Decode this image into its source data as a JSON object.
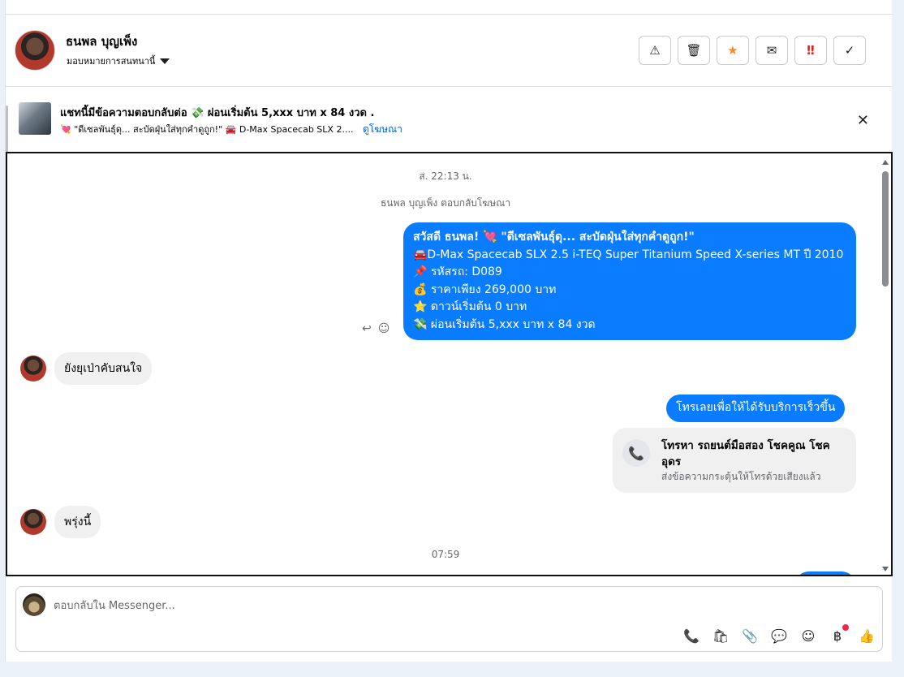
{
  "header": {
    "contact_name": "ธนพล บุญเพ็ง",
    "assign_label": "มอบหมายการสนทนานี้",
    "actions": [
      {
        "icon": "warning-icon",
        "glyph": "⚠"
      },
      {
        "icon": "trash-icon",
        "glyph": "🗑"
      },
      {
        "icon": "star-icon",
        "glyph": "★"
      },
      {
        "icon": "mark-unread-icon",
        "glyph": "✉"
      },
      {
        "icon": "important-icon",
        "glyph": "‼"
      },
      {
        "icon": "check-icon",
        "glyph": "✓"
      }
    ]
  },
  "ad": {
    "title": "แชทนี้มีข้อความตอบกลับต่อ 💸 ผ่อนเริ่มต้น 5,xxx บาท x 84 งวด .",
    "subtitle": "💘 \"ดีเซลพันธุ์ดุ... สะบัดฝุ่นใส่ทุกคำดูถูก!\" 🚘 D-Max Spacecab SLX 2....",
    "link": "ดูโฆษณา",
    "close_glyph": "✕"
  },
  "thread": {
    "timestamp1": "ส. 22:13 น.",
    "reply_note": "ธนพล บุญเพ็ง ตอบกลับโฆษณา",
    "ad_message_lines": [
      "สวัสดี ธนพล! 💘 \"ดีเซลพันธุ์ดุ... สะบัดฝุ่นใส่ทุกคำดูถูก!\"",
      "🚘D-Max Spacecab SLX 2.5 i-TEQ Super Titanium Speed X-series MT ปี 2010",
      "📌 รหัสรถ: D089",
      "💰 ราคาเพียง 269,000 บาท",
      "⭐ ดาวน์เริ่มต้น 0 บาท",
      "💸 ผ่อนเริ่มต้น 5,xxx บาท x 84 งวด"
    ],
    "reply_glyph": "↩",
    "react_glyph": "☺",
    "incoming1": "ยังยุเป่าคับสนใจ",
    "outgoing2": "โทรเลยเพื่อให้ได้รับบริการเร็วขึ้น",
    "call_card": {
      "title": "โทรหา รถยนต์มือสอง โชคคูณ โชค อุดร",
      "subtitle": "ส่งข้อความกระตุ้นให้โทรด้วยเสียงแล้ว",
      "glyph": "📞"
    },
    "incoming2": "พรุ่งนี้",
    "timestamp2": "07:59"
  },
  "composer": {
    "placeholder": "ตอบกลับใน Messenger...",
    "tools": [
      {
        "icon": "add-call-icon",
        "glyph": "📞"
      },
      {
        "icon": "shopping-bag-icon",
        "glyph": "🛍"
      },
      {
        "icon": "attachment-icon",
        "glyph": "📎"
      },
      {
        "icon": "saved-reply-icon",
        "glyph": "💬"
      },
      {
        "icon": "emoji-icon",
        "glyph": "☺"
      },
      {
        "icon": "baht-payment-icon",
        "glyph": "฿"
      },
      {
        "icon": "thumbs-up-icon",
        "glyph": "👍"
      }
    ]
  },
  "colors": {
    "outgoing_bubble": "#0a7cff",
    "incoming_bubble": "#f0f0f0",
    "link": "#0064d1",
    "star": "#f08c2a",
    "important": "#e02020"
  }
}
